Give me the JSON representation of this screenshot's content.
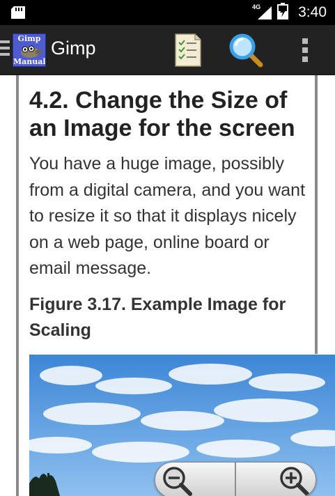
{
  "status_bar": {
    "network_label": "4G",
    "time": "3:40"
  },
  "action_bar": {
    "logo_line1": "Gimp",
    "logo_line2": "Manual",
    "title": "Gimp"
  },
  "article": {
    "heading": "4.2. Change the Size of an Image for the screen",
    "paragraph": "You have a huge image, possibly from a digital camera, and you want to resize it so that it displays nicely on a web page, online board or email message.",
    "figure_caption": "Figure 3.17. Example Image for Scaling"
  },
  "colors": {
    "status_bar_bg": "#000000",
    "action_bar_bg": "#222222",
    "logo_bg": "#4f5bd0",
    "page_bg": "#ffffff",
    "text": "#333333",
    "search_icon": "#3aa0e8"
  },
  "icons": [
    "sd-card-icon",
    "signal-icon",
    "battery-icon",
    "menu-icon",
    "checklist-icon",
    "search-icon",
    "overflow-menu-icon",
    "zoom-out-icon",
    "zoom-in-icon"
  ]
}
